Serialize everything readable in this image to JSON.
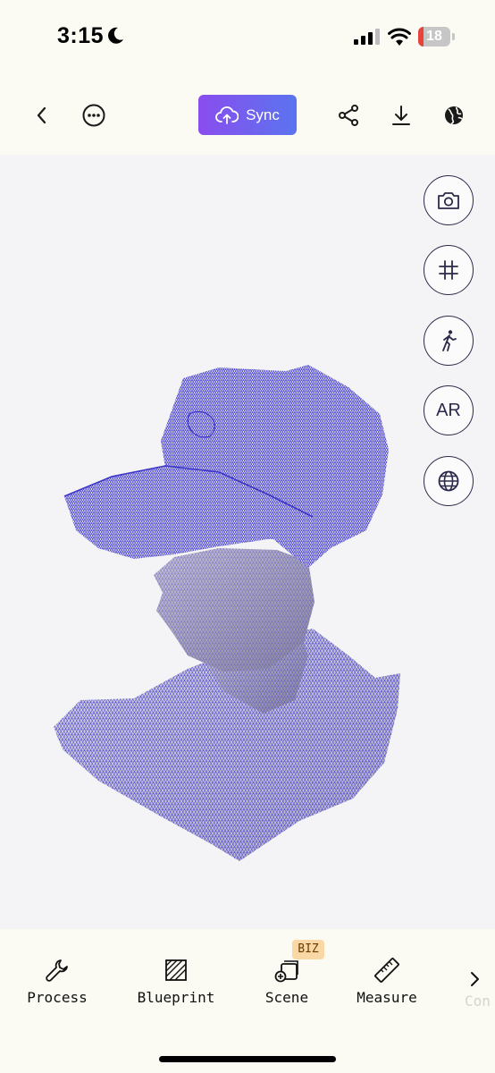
{
  "status_bar": {
    "time": "3:15",
    "battery": "18",
    "battery_percent": 18
  },
  "toolbar": {
    "sync_label": "Sync",
    "back_icon": "chevron-left-icon",
    "more_icon": "ellipsis-circle-icon",
    "share_icon": "share-icon",
    "download_icon": "download-icon",
    "globe_icon": "globe-icon",
    "sync_gradient": [
      "#8a4dee",
      "#5a74ef"
    ]
  },
  "viewport": {
    "model": "wireframe mesh of head wearing cap",
    "mesh_color": "#4a44d6",
    "side_buttons": [
      {
        "icon": "camera-icon"
      },
      {
        "icon": "grid-icon"
      },
      {
        "icon": "walk-icon"
      },
      {
        "label": "AR"
      },
      {
        "icon": "globe-icon"
      }
    ]
  },
  "bottom_tabs": [
    {
      "label": "Process",
      "icon": "wrench-icon"
    },
    {
      "label": "Blueprint",
      "icon": "blueprint-icon"
    },
    {
      "label": "Scene",
      "icon": "scene-add-icon",
      "badge": "BIZ"
    },
    {
      "label": "Measure",
      "icon": "ruler-icon"
    },
    {
      "label": "Con"
    }
  ]
}
